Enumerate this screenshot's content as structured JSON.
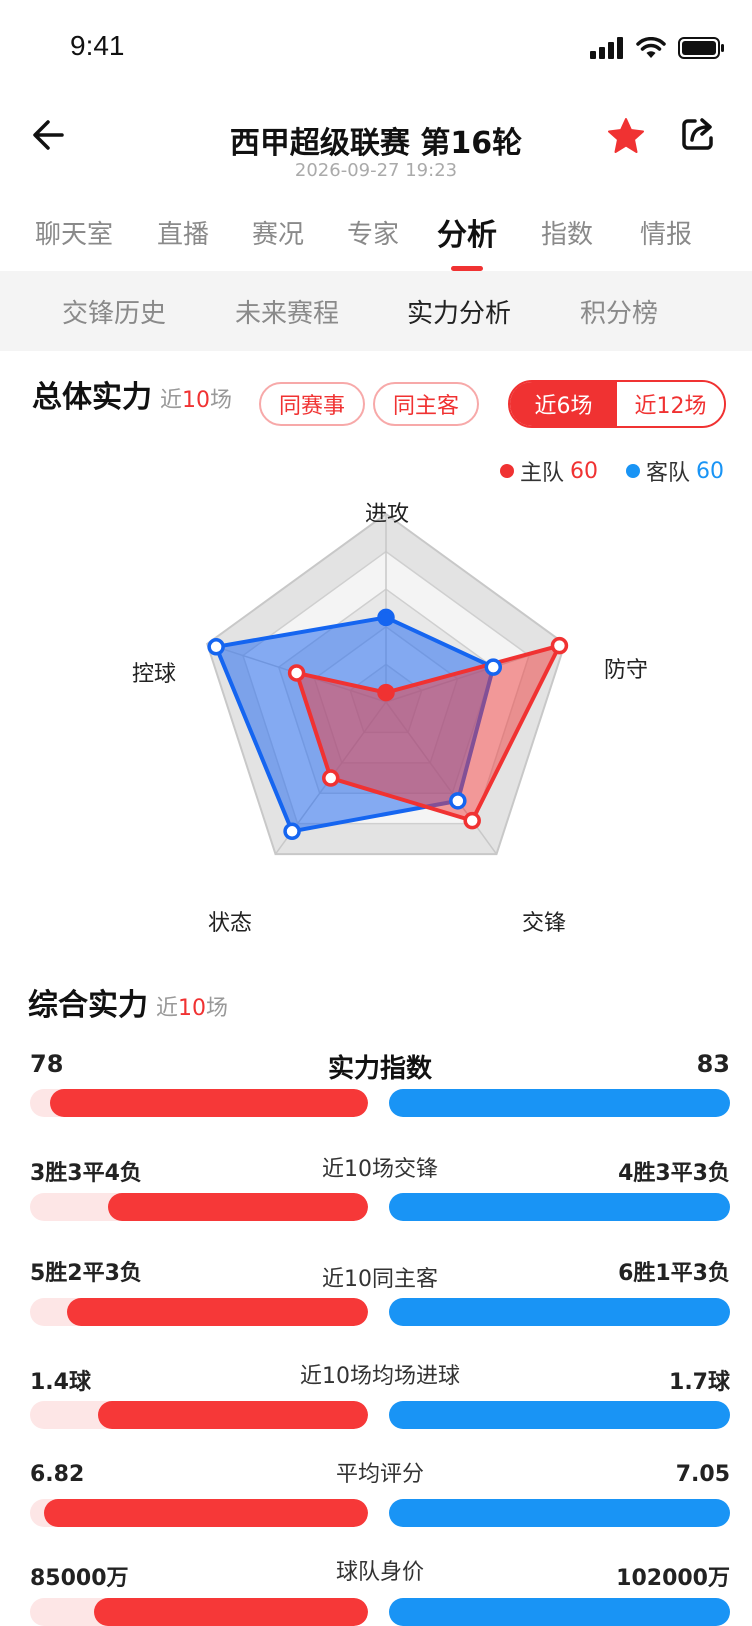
{
  "status_bar": {
    "time": "9:41"
  },
  "header": {
    "title": "西甲超级联赛 第16轮",
    "datetime": "2026-09-27  19:23"
  },
  "main_tabs": [
    {
      "label": "聊天室",
      "active": false
    },
    {
      "label": "直播",
      "active": false
    },
    {
      "label": "赛况",
      "active": false
    },
    {
      "label": "专家",
      "active": false
    },
    {
      "label": "分析",
      "active": true
    },
    {
      "label": "指数",
      "active": false
    },
    {
      "label": "情报",
      "active": false
    }
  ],
  "sub_tabs": [
    {
      "label": "交锋历史",
      "active": false
    },
    {
      "label": "未来赛程",
      "active": false
    },
    {
      "label": "实力分析",
      "active": true
    },
    {
      "label": "积分榜",
      "active": false
    }
  ],
  "overall": {
    "title": "总体实力",
    "sub_prefix": "近",
    "sub_num": "10",
    "sub_suffix": "场",
    "filters": [
      "同赛事",
      "同主客"
    ],
    "range_options": [
      {
        "label": "近6场",
        "selected": true
      },
      {
        "label": "近12场",
        "selected": false
      }
    ],
    "legend": {
      "home_label": "主队",
      "home_value": "60",
      "away_label": "客队",
      "away_value": "60"
    }
  },
  "radar": {
    "axes": [
      "进攻",
      "防守",
      "交锋",
      "状态",
      "控球"
    ],
    "home_values": [
      0.05,
      0.97,
      0.78,
      0.5,
      0.5
    ],
    "away_values": [
      0.45,
      0.6,
      0.65,
      0.85,
      0.95
    ],
    "home_color": "#f03232",
    "away_color": "#1565f0"
  },
  "composite": {
    "title": "综合实力",
    "sub_prefix": "近",
    "sub_num": "10",
    "sub_suffix": "场",
    "rows": [
      {
        "label": "实力指数",
        "home": "78",
        "away": "83",
        "home_fill": 0.94
      },
      {
        "label": "近10场交锋",
        "home": "3胜3平4负",
        "away": "4胜3平3负",
        "home_fill": 0.77
      },
      {
        "label": "近10同主客",
        "home": "5胜2平3负",
        "away": "6胜1平3负",
        "home_fill": 0.89
      },
      {
        "label": "近10场均场进球",
        "home": "1.4球",
        "away": "1.7球",
        "home_fill": 0.8
      },
      {
        "label": "平均评分",
        "home": "6.82",
        "away": "7.05",
        "home_fill": 0.96
      },
      {
        "label": "球队身价",
        "home": "85000万",
        "away": "102000万",
        "home_fill": 0.81
      }
    ]
  },
  "colors": {
    "accent": "#f03232",
    "away": "#1994f5",
    "home_bar": "#f63838"
  }
}
